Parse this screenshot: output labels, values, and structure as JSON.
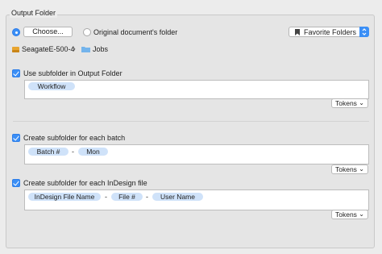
{
  "output_folder": {
    "title": "Output Folder",
    "choose_label": "Choose...",
    "original_folder_label": "Original document's folder",
    "favorite_folders_label": "Favorite Folders",
    "path": {
      "drive": "SeagateE-500-4",
      "folder": "Jobs"
    }
  },
  "subfolder_output": {
    "label": "Use subfolder in Output Folder",
    "checked": true,
    "tokens": [
      "Workflow"
    ],
    "tokens_menu": "Tokens"
  },
  "subfolder_batch": {
    "label": "Create subfolder for each batch",
    "checked": true,
    "tokens": [
      "Batch #",
      "Mon"
    ],
    "separator": "-",
    "tokens_menu": "Tokens"
  },
  "subfolder_indesign": {
    "label": "Create subfolder for each InDesign file",
    "checked": true,
    "tokens": [
      "InDesign File Name",
      "File #",
      "User Name"
    ],
    "separators": [
      "-",
      "-"
    ],
    "tokens_menu": "Tokens"
  },
  "colors": {
    "accent": "#3b8ff6",
    "token_bg": "#cfe2f9"
  }
}
